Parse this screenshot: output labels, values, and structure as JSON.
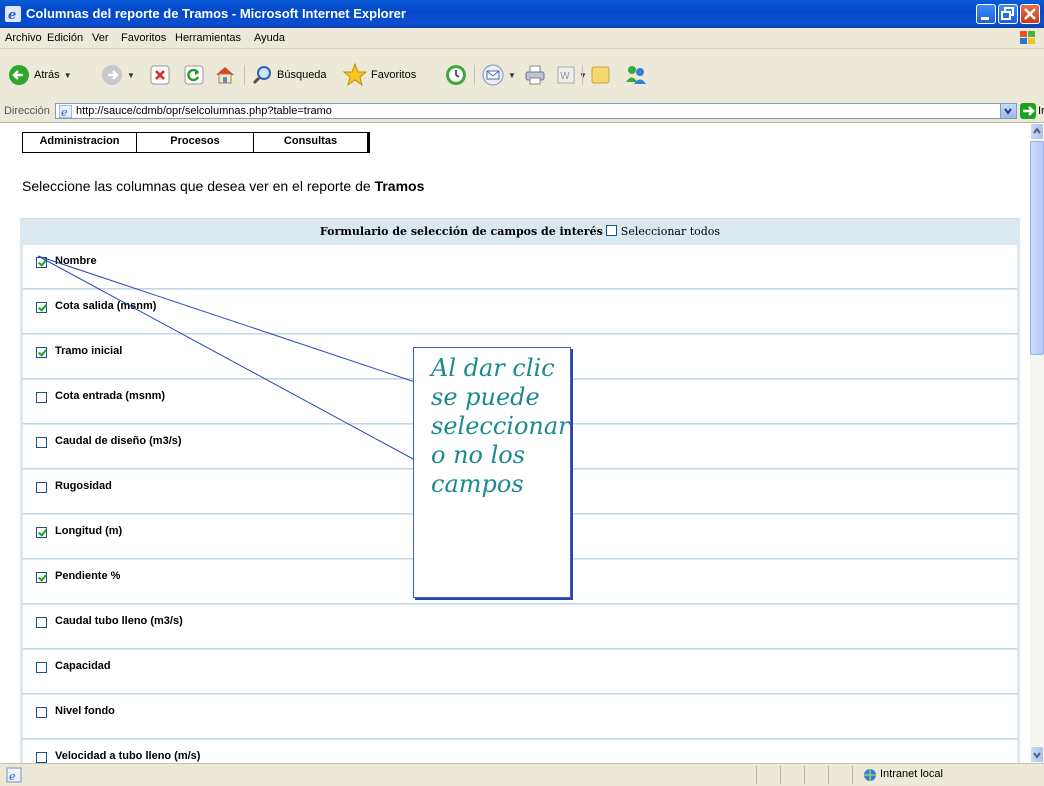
{
  "window": {
    "title": "Columnas del reporte de Tramos - Microsoft Internet Explorer"
  },
  "menu": [
    "Archivo",
    "Edición",
    "Ver",
    "Favoritos",
    "Herramientas",
    "Ayuda"
  ],
  "toolbar": {
    "back_label": "Atrás",
    "search_label": "Búsqueda",
    "favorites_label": "Favoritos"
  },
  "address": {
    "label": "Dirección",
    "url": "http://sauce/cdmb/opr/selcolumnas.php?table=tramo",
    "go_label": "Ir"
  },
  "nav_tabs": [
    "Administracion",
    "Procesos",
    "Consultas"
  ],
  "page": {
    "lead_text": "Seleccione las columnas que desea ver en el reporte de ",
    "lead_bold": "Tramos"
  },
  "form": {
    "header": "Formulario de selección de campos de interés",
    "select_all_label": "Seleccionar todos",
    "select_all_checked": false,
    "fields": [
      {
        "label": "Nombre",
        "checked": true
      },
      {
        "label": "Cota salida (msnm)",
        "checked": true
      },
      {
        "label": "Tramo inicial",
        "checked": true
      },
      {
        "label": "Cota entrada (msnm)",
        "checked": false
      },
      {
        "label": "Caudal de diseño (m3/s)",
        "checked": false
      },
      {
        "label": "Rugosidad",
        "checked": false
      },
      {
        "label": "Longitud (m)",
        "checked": true
      },
      {
        "label": "Pendiente %",
        "checked": true
      },
      {
        "label": "Caudal tubo lleno (m3/s)",
        "checked": false
      },
      {
        "label": "Capacidad",
        "checked": false
      },
      {
        "label": "Nivel fondo",
        "checked": false
      },
      {
        "label": "Velocidad a tubo lleno (m/s)",
        "checked": false
      }
    ]
  },
  "callout": {
    "text": "Al dar clic se puede seleccionar o no los campos"
  },
  "status": {
    "zone": "Intranet local"
  }
}
